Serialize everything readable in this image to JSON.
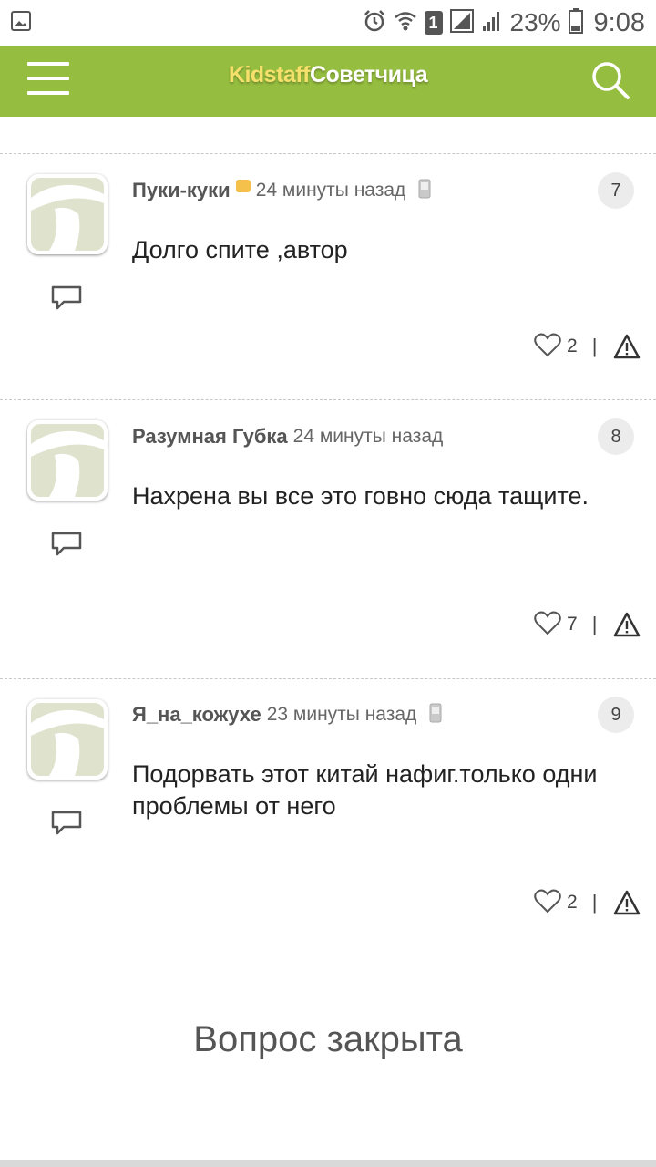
{
  "status_bar": {
    "battery_percent": "23%",
    "time": "9:08",
    "sim_slot": "1",
    "icons": [
      "gallery-icon",
      "alarm-icon",
      "wifi-icon",
      "sim-icon",
      "signal-icon",
      "signal-icon",
      "battery-icon"
    ]
  },
  "app_bar": {
    "brand_part1": "Kidstaff",
    "brand_part2": "Советчица",
    "bg_color": "#95bd3f",
    "brand_part1_color": "#f5e06b",
    "icons": [
      "menu-icon",
      "search-icon"
    ]
  },
  "comments": [
    {
      "author": "Пуки-куки",
      "has_status_dot": true,
      "time": "24 минуты назад",
      "mobile": true,
      "number": "7",
      "text": "Долго спите ,автор",
      "likes": "2"
    },
    {
      "author": "Разумная Губка",
      "has_status_dot": false,
      "time": "24 минуты назад",
      "mobile": false,
      "number": "8",
      "text": "Нахрена вы все это говно сюда тащите.",
      "likes": "7"
    },
    {
      "author": "Я_на_кожухе",
      "has_status_dot": false,
      "time": "23 минуты назад",
      "mobile": true,
      "number": "9",
      "text": "Подорвать этот китай нафиг.только одни проблемы от него",
      "likes": "2"
    }
  ],
  "comment_separator": "|",
  "closed_message": "Вопрос закрыта"
}
